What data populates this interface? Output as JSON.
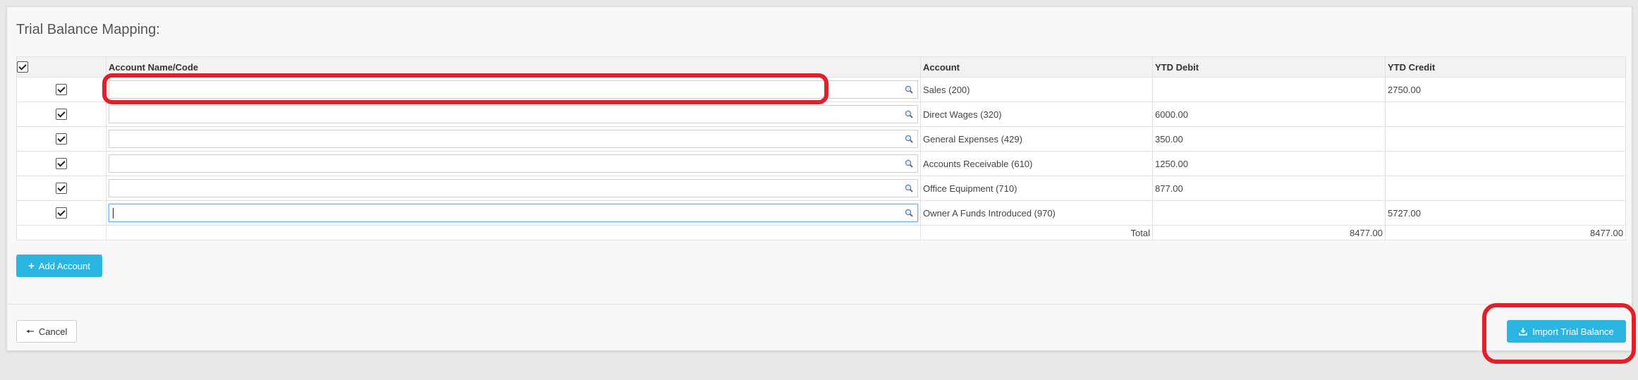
{
  "page": {
    "title": "Trial Balance Mapping:"
  },
  "table": {
    "headers": {
      "account_name_code": "Account Name/Code",
      "account": "Account",
      "ytd_debit": "YTD Debit",
      "ytd_credit": "YTD Credit"
    },
    "rows": [
      {
        "checked": true,
        "name_code": "",
        "account": "Sales (200)",
        "ytd_debit": "",
        "ytd_credit": "2750.00"
      },
      {
        "checked": true,
        "name_code": "",
        "account": "Direct Wages (320)",
        "ytd_debit": "6000.00",
        "ytd_credit": ""
      },
      {
        "checked": true,
        "name_code": "",
        "account": "General Expenses (429)",
        "ytd_debit": "350.00",
        "ytd_credit": ""
      },
      {
        "checked": true,
        "name_code": "",
        "account": "Accounts Receivable (610)",
        "ytd_debit": "1250.00",
        "ytd_credit": ""
      },
      {
        "checked": true,
        "name_code": "",
        "account": "Office Equipment (710)",
        "ytd_debit": "877.00",
        "ytd_credit": ""
      },
      {
        "checked": true,
        "name_code": "",
        "account": "Owner A Funds Introduced (970)",
        "ytd_debit": "",
        "ytd_credit": "5727.00"
      }
    ],
    "total": {
      "label": "Total",
      "ytd_debit": "8477.00",
      "ytd_credit": "8477.00"
    }
  },
  "buttons": {
    "add_account": "Add Account",
    "cancel": "Cancel",
    "import_trial_balance": "Import Trial Balance"
  },
  "colors": {
    "accent": "#2bb5e1",
    "highlight": "#e2202b"
  },
  "icons": {
    "search": "search-icon",
    "plus": "plus-icon",
    "back": "arrow-left-icon",
    "download": "download-icon"
  }
}
